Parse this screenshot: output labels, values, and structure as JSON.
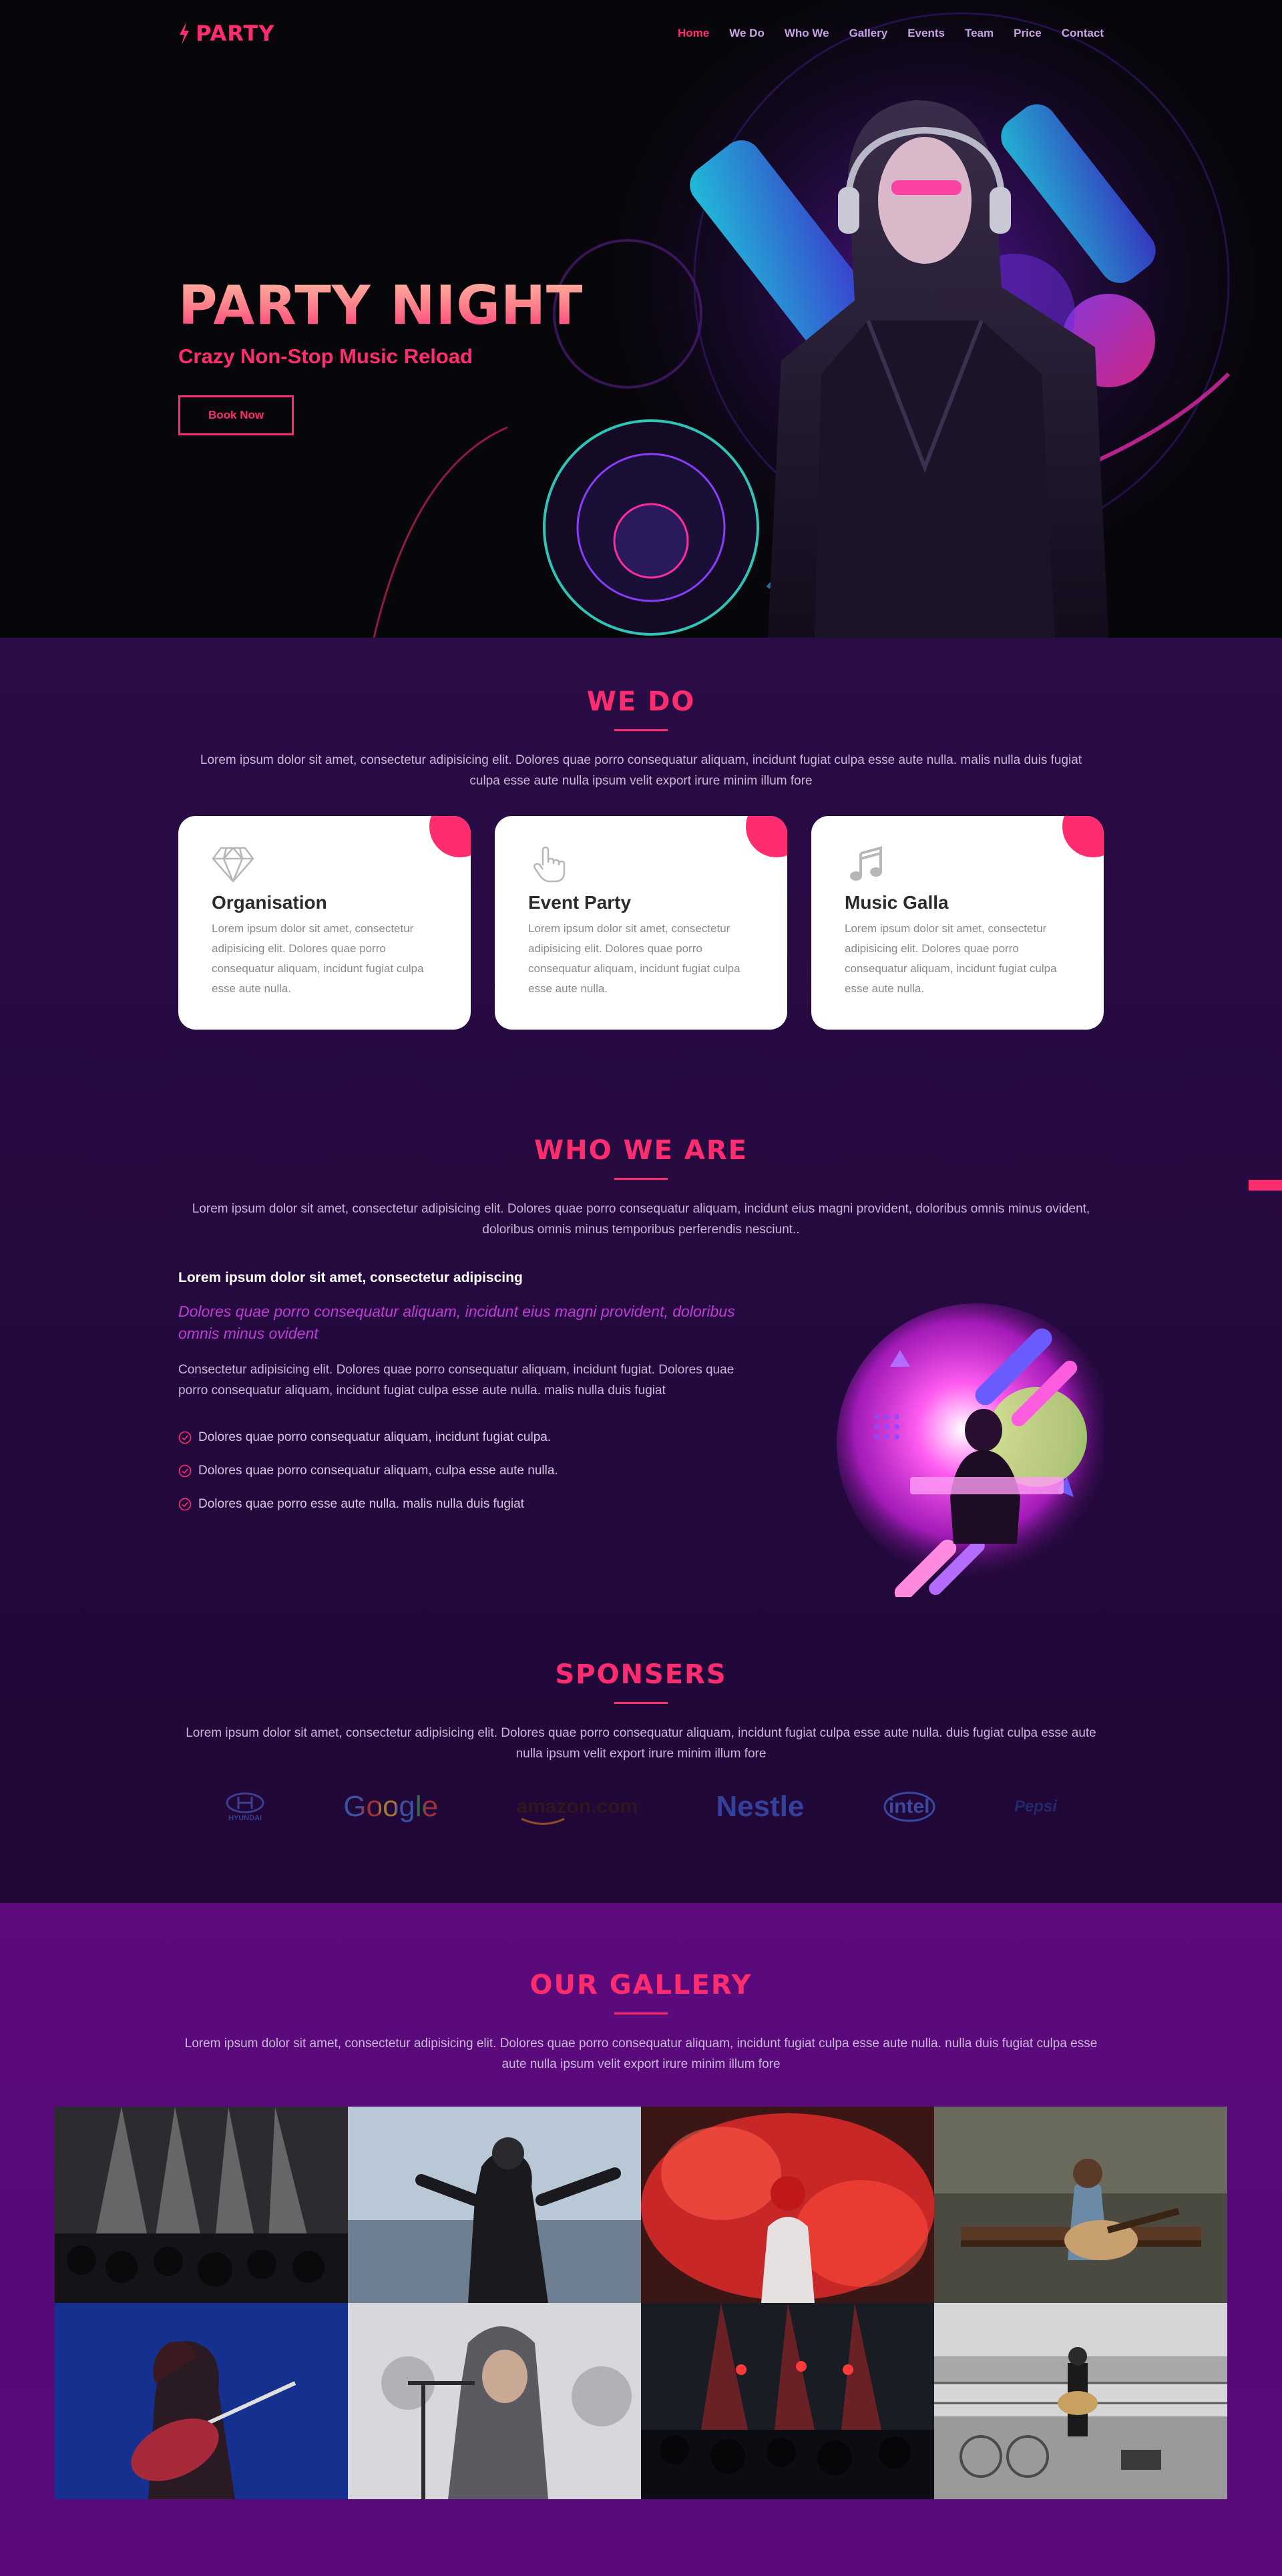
{
  "nav": {
    "logo": "PARTY",
    "links": [
      "Home",
      "We Do",
      "Who We",
      "Gallery",
      "Events",
      "Team",
      "Price",
      "Contact"
    ],
    "active": "Home"
  },
  "hero": {
    "title": "PARTY NIGHT",
    "subtitle": "Crazy Non-Stop Music Reload",
    "button": "Book Now"
  },
  "wedo": {
    "title": "WE DO",
    "description": "Lorem ipsum dolor sit amet, consectetur adipisicing elit. Dolores quae porro consequatur aliquam, incidunt fugiat culpa esse aute nulla. malis nulla duis fugiat culpa esse aute nulla ipsum velit export irure minim illum fore",
    "cards": [
      {
        "title": "Organisation",
        "icon": "diamond-icon",
        "text": "Lorem ipsum dolor sit amet, consectetur adipisicing elit. Dolores quae porro consequatur aliquam, incidunt fugiat culpa esse aute nulla."
      },
      {
        "title": "Event Party",
        "icon": "pointer-hand-icon",
        "text": "Lorem ipsum dolor sit amet, consectetur adipisicing elit. Dolores quae porro consequatur aliquam, incidunt fugiat culpa esse aute nulla."
      },
      {
        "title": "Music Galla",
        "icon": "music-note-icon",
        "text": "Lorem ipsum dolor sit amet, consectetur adipisicing elit. Dolores quae porro consequatur aliquam, incidunt fugiat culpa esse aute nulla."
      }
    ]
  },
  "whoweare": {
    "title": "WHO WE ARE",
    "description": "Lorem ipsum dolor sit amet, consectetur adipisicing elit. Dolores quae porro consequatur aliquam, incidunt eius magni provident, doloribus omnis minus ovident, doloribus omnis minus temporibus perferendis nesciunt..",
    "heading": "Lorem ipsum dolor sit amet, consectetur adipiscing",
    "italic": "Dolores quae porro consequatur aliquam, incidunt eius magni provident, doloribus omnis minus ovident",
    "paragraph": "Consectetur adipisicing elit. Dolores quae porro consequatur aliquam, incidunt fugiat. Dolores quae porro consequatur aliquam, incidunt fugiat culpa esse aute nulla. malis nulla duis fugiat",
    "list": [
      "Dolores quae porro consequatur aliquam, incidunt fugiat culpa.",
      "Dolores quae porro consequatur aliquam, culpa esse aute nulla.",
      "Dolores quae porro esse aute nulla. malis nulla duis fugiat"
    ]
  },
  "sponsors": {
    "title": "SPONSERS",
    "description": "Lorem ipsum dolor sit amet, consectetur adipisicing elit. Dolores quae porro consequatur aliquam, incidunt fugiat culpa esse aute nulla. duis fugiat culpa esse aute nulla ipsum velit export irure minim illum fore",
    "logos": [
      "HYUNDAI",
      "Google",
      "amazon.com",
      "Nestle",
      "intel",
      "Pepsi"
    ]
  },
  "gallery": {
    "title": "OUR GALLERY",
    "description": "Lorem ipsum dolor sit amet, consectetur adipisicing elit. Dolores quae porro consequatur aliquam, incidunt fugiat culpa esse aute nulla. nulla duis fugiat culpa esse aute nulla ipsum velit export irure minim illum fore"
  },
  "colors": {
    "accent": "#ff2d6f",
    "band": "#24093e",
    "gallery": "#580979",
    "hero": "#07060a"
  }
}
